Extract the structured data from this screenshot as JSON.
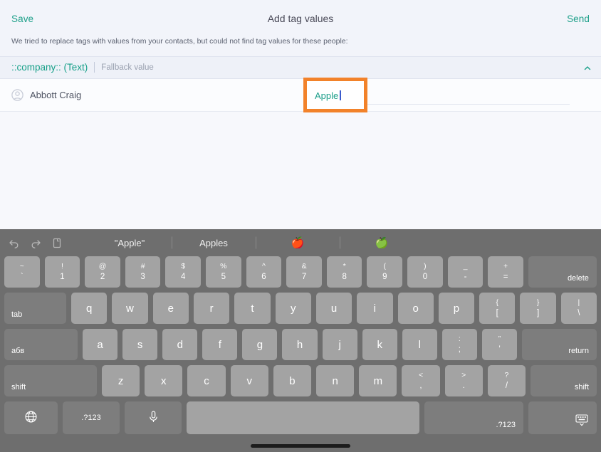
{
  "nav": {
    "save_label": "Save",
    "title": "Add tag values",
    "send_label": "Send"
  },
  "subtitle": "We tried to replace tags with values from your contacts, but could not find tag values for these people:",
  "section": {
    "tag_name": "::company:: (Text)",
    "fallback_label": "Fallback value",
    "collapse_icon": "chevron-up-icon"
  },
  "contact": {
    "avatar_icon": "contact-avatar-icon",
    "name": "Abbott Craig",
    "value": "Apple"
  },
  "highlight": {
    "color": "#f2822a",
    "value": "Apple"
  },
  "colors": {
    "accent_teal": "#1fa08a",
    "highlight_orange": "#f2822a",
    "app_bg": "#f7f8fc",
    "keyboard_bg": "#6e6e6e"
  },
  "keyboard": {
    "suggestions": {
      "undo_icon": "undo-icon",
      "redo_icon": "redo-icon",
      "paste_icon": "paste-icon",
      "items": [
        "\"Apple\"",
        "Apples"
      ],
      "emoji": [
        "🍎",
        "🍏"
      ]
    },
    "row1": [
      {
        "top": "~",
        "bot": "`"
      },
      {
        "top": "!",
        "bot": "1"
      },
      {
        "top": "@",
        "bot": "2"
      },
      {
        "top": "#",
        "bot": "3"
      },
      {
        "top": "$",
        "bot": "4"
      },
      {
        "top": "%",
        "bot": "5"
      },
      {
        "top": "^",
        "bot": "6"
      },
      {
        "top": "&",
        "bot": "7"
      },
      {
        "top": "*",
        "bot": "8"
      },
      {
        "top": "(",
        "bot": "9"
      },
      {
        "top": ")",
        "bot": "0"
      },
      {
        "top": "_",
        "bot": "-"
      },
      {
        "top": "+",
        "bot": "="
      }
    ],
    "delete_label": "delete",
    "tab_label": "tab",
    "row2": [
      {
        "single": "q"
      },
      {
        "single": "w"
      },
      {
        "single": "e"
      },
      {
        "single": "r"
      },
      {
        "single": "t"
      },
      {
        "single": "y"
      },
      {
        "single": "u"
      },
      {
        "single": "i"
      },
      {
        "single": "o"
      },
      {
        "single": "p"
      },
      {
        "top": "{",
        "bot": "["
      },
      {
        "top": "}",
        "bot": "]"
      },
      {
        "top": "|",
        "bot": "\\"
      }
    ],
    "caps_label": "абв",
    "row3": [
      {
        "single": "a"
      },
      {
        "single": "s"
      },
      {
        "single": "d"
      },
      {
        "single": "f"
      },
      {
        "single": "g"
      },
      {
        "single": "h"
      },
      {
        "single": "j"
      },
      {
        "single": "k"
      },
      {
        "single": "l"
      },
      {
        "top": ":",
        "bot": ";"
      },
      {
        "top": "”",
        "bot": "’"
      }
    ],
    "return_label": "return",
    "shift_left_label": "shift",
    "row4": [
      {
        "single": "z"
      },
      {
        "single": "x"
      },
      {
        "single": "c"
      },
      {
        "single": "v"
      },
      {
        "single": "b"
      },
      {
        "single": "n"
      },
      {
        "single": "m"
      },
      {
        "top": "<",
        "bot": ","
      },
      {
        "top": ">",
        "bot": "."
      },
      {
        "top": "?",
        "bot": "/"
      }
    ],
    "shift_right_label": "shift",
    "bottom": {
      "globe_icon": "globe-icon",
      "num_left_label": ".?123",
      "mic_icon": "microphone-icon",
      "space_label": "",
      "num_right_label": ".?123",
      "hide_keyboard_icon": "hide-keyboard-icon"
    }
  }
}
